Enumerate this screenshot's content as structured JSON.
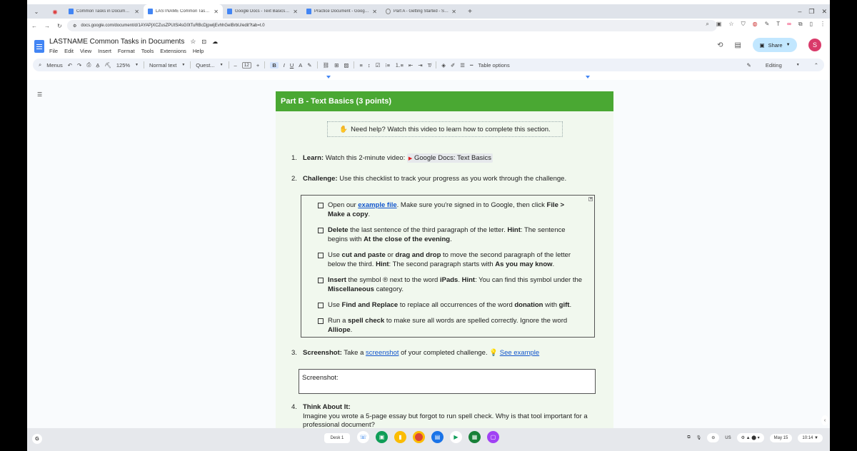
{
  "browser": {
    "tabs": [
      {
        "title": "Common Tasks in Documents",
        "active": false
      },
      {
        "title": "LASTNAME Common Tasks in Documents",
        "active": true
      },
      {
        "title": "Google Docs - Text Basics - Go",
        "active": false
      },
      {
        "title": "Practice Document - Google Docs",
        "active": false
      },
      {
        "title": "Part A - Getting Started - Screencast",
        "active": false
      }
    ],
    "url": "docs.google.com/document/d/1AYAPjXCZusZPUtSi4sG0tTuRBcDjpwljEvhhGelBrbU/edit?tab=t.0"
  },
  "docs": {
    "title": "LASTNAME Common Tasks in Documents",
    "menu": [
      "File",
      "Edit",
      "View",
      "Insert",
      "Format",
      "Tools",
      "Extensions",
      "Help"
    ],
    "share_label": "Share",
    "avatar_letter": "S",
    "toolbar": {
      "menus_label": "Menus",
      "zoom": "125%",
      "style": "Normal text",
      "font": "Quest...",
      "font_size": "12",
      "table_options": "Table options",
      "mode": "Editing"
    }
  },
  "document": {
    "part_title": "Part B - Text Basics (3 points)",
    "help_text": "Need help? Watch this video to learn how to complete this section.",
    "step1": {
      "num": "1.",
      "label": "Learn:",
      "text": "Watch this 2-minute video:",
      "chip": "Google Docs: Text Basics"
    },
    "step2": {
      "num": "2.",
      "label": "Challenge:",
      "text": "Use this checklist to track your progress as you work through the challenge."
    },
    "checklist": {
      "i1_a": "Open our ",
      "i1_link": "example file",
      "i1_b": ". Make sure you're signed in to Google, then click ",
      "i1_c": "File >",
      "i1_d": "Make a copy",
      "i1_e": ".",
      "i2_a": "Delete",
      "i2_b": " the last sentence of the third paragraph of the letter. ",
      "i2_c": "Hint",
      "i2_d": ": The sentence begins with ",
      "i2_e": "At the close of the evening",
      "i2_f": ".",
      "i3_a": "Use ",
      "i3_b": "cut and paste",
      "i3_c": " or ",
      "i3_d": "drag and drop",
      "i3_e": " to move the second paragraph of the letter below the third. ",
      "i3_f": "Hint",
      "i3_g": ": The second paragraph starts with ",
      "i3_h": "As you may know",
      "i3_i": ".",
      "i4_a": "Insert",
      "i4_b": " the symbol ® next to the word ",
      "i4_c": "iPads",
      "i4_d": ". ",
      "i4_e": "Hint",
      "i4_f": ": You can find this symbol under the ",
      "i4_g": "Miscellaneous",
      "i4_h": " category.",
      "i5_a": "Use ",
      "i5_b": "Find and Replace",
      "i5_c": " to replace all occurrences of the word ",
      "i5_d": "donation",
      "i5_e": " with ",
      "i5_f": "gift",
      "i5_g": ".",
      "i6_a": "Run a ",
      "i6_b": "spell check",
      "i6_c": " to make sure all words are spelled correctly. Ignore the word ",
      "i6_d": "Alliope",
      "i6_e": "."
    },
    "step3": {
      "num": "3.",
      "label": "Screenshot:",
      "text_a": "Take a ",
      "link1": "screenshot",
      "text_b": " of your completed challenge. ",
      "link2": "See example"
    },
    "screenshot_box": "Screenshot:",
    "step4": {
      "num": "4.",
      "label": "Think About It:",
      "text": "Imagine you wrote a 5-page essay but forgot to run spell check. Why is that tool important for a professional document?"
    }
  },
  "shelf": {
    "launcher": "G",
    "desk": "Desk 1",
    "region": "US",
    "date": "May 15",
    "time": "10:14"
  }
}
